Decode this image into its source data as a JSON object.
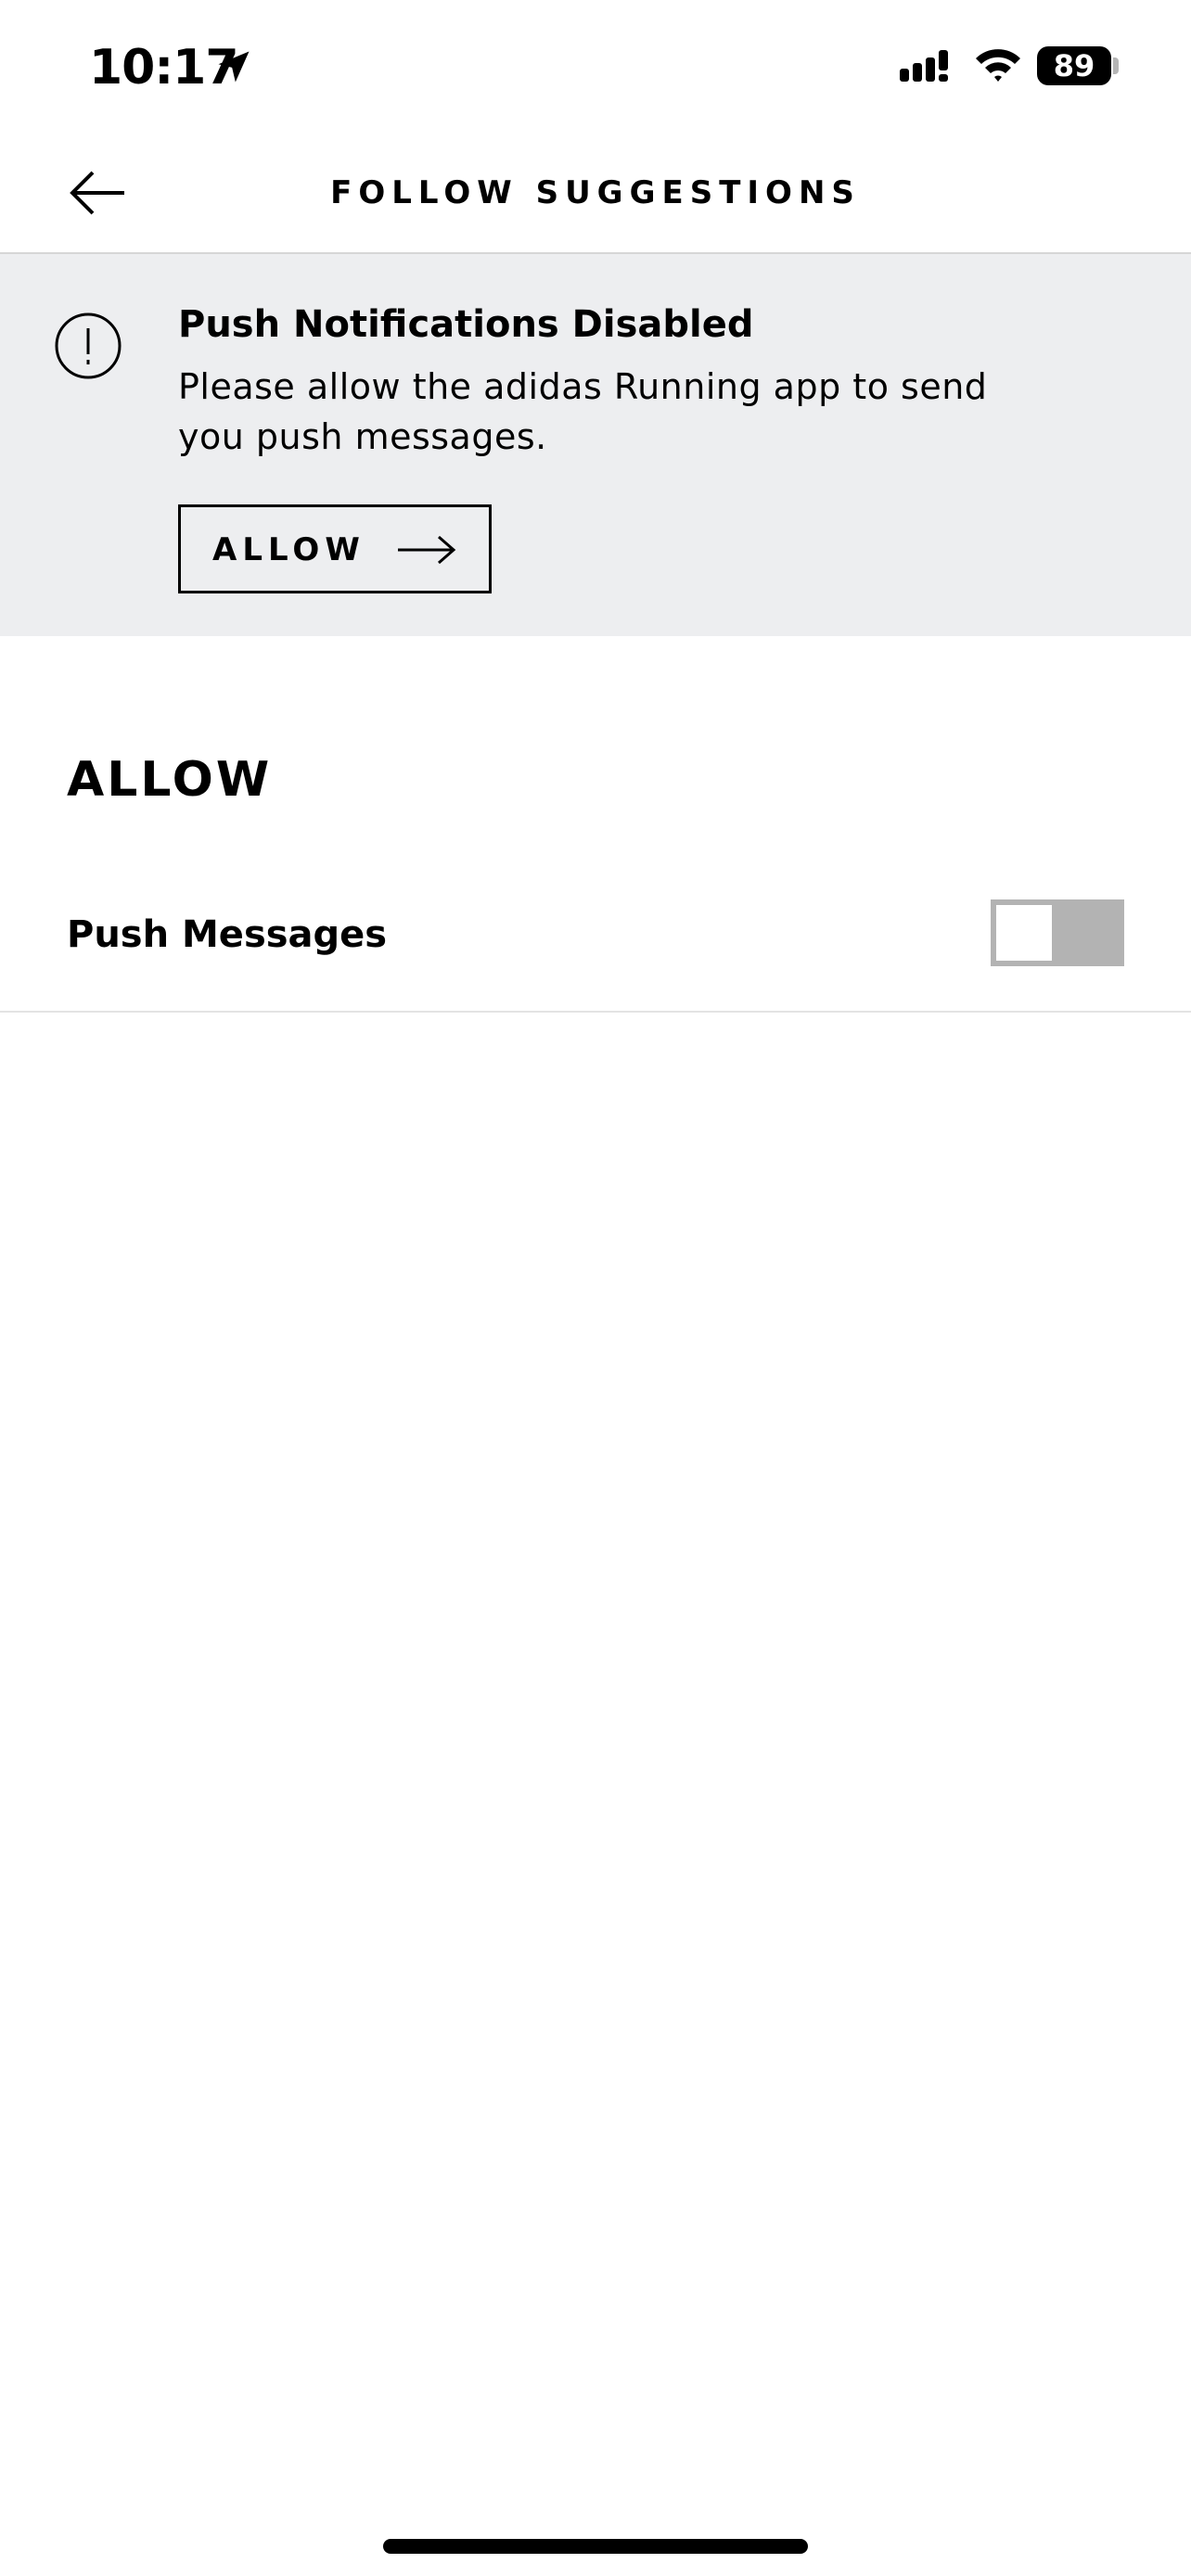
{
  "status_bar": {
    "time": "10:17",
    "battery": "89",
    "icons": [
      "location-arrow-icon",
      "cellular-signal-icon",
      "wifi-icon",
      "battery-icon"
    ]
  },
  "header": {
    "title": "FOLLOW SUGGESTIONS",
    "back_icon": "arrow-left-icon"
  },
  "banner": {
    "icon": "alert-circle-icon",
    "title": "Push Notifications Disabled",
    "text": "Please allow the adidas Running app to send you push messages.",
    "button_label": "ALLOW",
    "button_icon": "arrow-right-icon"
  },
  "settings": {
    "heading": "ALLOW",
    "rows": [
      {
        "label": "Push Messages",
        "enabled": false
      }
    ]
  },
  "colors": {
    "banner_bg": "#edeef0",
    "toggle_off": "#b3b3b3",
    "divider": "#d6d6d6"
  }
}
